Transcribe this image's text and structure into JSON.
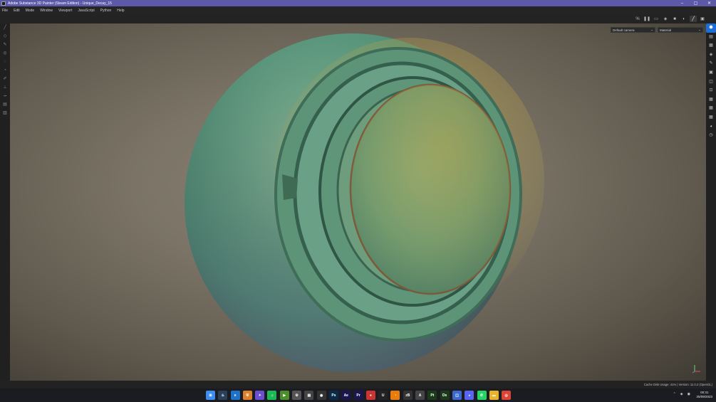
{
  "titlebar": {
    "title": "Adobe Substance 3D Painter (Steam Edition) - Unique_Decay_15",
    "minimize": "–",
    "maximize": "▢",
    "close": "✕"
  },
  "menu": [
    "File",
    "Edit",
    "Mode",
    "Window",
    "Viewport",
    "JavaScript",
    "Python",
    "Help"
  ],
  "toolbar": {
    "icons": [
      "percent-icon",
      "pause-icon",
      "frame-icon",
      "render-icon",
      "video-icon",
      "lighting-icon",
      "brush-icon",
      "camera-snapshot-icon"
    ],
    "glyphs": [
      "%",
      "❚❚",
      "▭",
      "◈",
      "■",
      "◐",
      "╱",
      "▣"
    ],
    "percent_label": "%"
  },
  "left_tools": {
    "icons": [
      "paint-brush-icon",
      "eraser-icon",
      "projection-icon",
      "geometry-mask-icon",
      "smudge-icon",
      "clone-icon",
      "picker-icon",
      "stamp-icon",
      "polygon-fill-icon",
      "bake-icon",
      "display-icon"
    ],
    "glyphs": [
      "╱",
      "◇",
      "✎",
      "◎",
      "◌",
      "◔",
      "✐",
      "⊥",
      "⤞",
      "▤",
      "▥"
    ]
  },
  "right_tools": {
    "icons": [
      "assets-icon",
      "texture-set-icon",
      "layers-icon",
      "properties-icon",
      "brush-settings-icon",
      "display-settings-icon",
      "shader-icon",
      "export-icon",
      "grid-icon",
      "grid2-icon",
      "grid3-icon",
      "sphere-icon",
      "history-icon"
    ],
    "glyphs": [
      "⬢",
      "▤",
      "▦",
      "◈",
      "✎",
      "▣",
      "◫",
      "⊡",
      "▦",
      "▦",
      "▦",
      "◕",
      "◷"
    ]
  },
  "viewport": {
    "camera": "Default camera",
    "mode": "Material"
  },
  "status": {
    "text": "Cache Disk Usage:  41% | Version: 11.0.2 (OpenGL)"
  },
  "taskbar": {
    "apps": [
      {
        "name": "windows-start-icon",
        "glyph": "⊞",
        "color": "#3d8cf0"
      },
      {
        "name": "steam-icon",
        "glyph": "♨",
        "color": "#2a3f5a"
      },
      {
        "name": "edge-icon",
        "glyph": "e",
        "color": "#1e73c8"
      },
      {
        "name": "shield-icon",
        "glyph": "⛨",
        "color": "#d9822b"
      },
      {
        "name": "sparkle-icon",
        "glyph": "✦",
        "color": "#6b4fd0"
      },
      {
        "name": "spotify-icon",
        "glyph": "♫",
        "color": "#1db954"
      },
      {
        "name": "play-icon",
        "glyph": "▶",
        "color": "#4a8f2a"
      },
      {
        "name": "settings-icon",
        "glyph": "⚙",
        "color": "#555"
      },
      {
        "name": "notes-icon",
        "glyph": "▤",
        "color": "#444"
      },
      {
        "name": "obs-icon",
        "glyph": "◉",
        "color": "#333"
      },
      {
        "name": "photoshop-icon",
        "glyph": "Ps",
        "color": "#0a2a4a"
      },
      {
        "name": "after-effects-icon",
        "glyph": "Ae",
        "color": "#1a1650"
      },
      {
        "name": "premiere-icon",
        "glyph": "Pr",
        "color": "#1a1650"
      },
      {
        "name": "record-icon",
        "glyph": "●",
        "color": "#c33"
      },
      {
        "name": "unreal-icon",
        "glyph": "U",
        "color": "#222"
      },
      {
        "name": "blender-icon",
        "glyph": "◔",
        "color": "#e87d0d"
      },
      {
        "name": "zbrush-icon",
        "glyph": "zB",
        "color": "#333"
      },
      {
        "name": "text-icon",
        "glyph": "A",
        "color": "#444"
      },
      {
        "name": "painter-icon",
        "glyph": "Pt",
        "color": "#1a3a1a"
      },
      {
        "name": "designer-icon",
        "glyph": "Ds",
        "color": "#1a3a1a"
      },
      {
        "name": "stack-icon",
        "glyph": "◫",
        "color": "#3a6ad0"
      },
      {
        "name": "discord-icon",
        "glyph": "◕",
        "color": "#5865f2"
      },
      {
        "name": "whatsapp-icon",
        "glyph": "✆",
        "color": "#25d366"
      },
      {
        "name": "folder-icon",
        "glyph": "▬",
        "color": "#e7b32c"
      },
      {
        "name": "chrome-icon",
        "glyph": "◎",
        "color": "#db4437"
      }
    ],
    "tray": [
      "⌃",
      "◈",
      "◉"
    ],
    "time": "00:31",
    "date": "25/09/2023"
  }
}
